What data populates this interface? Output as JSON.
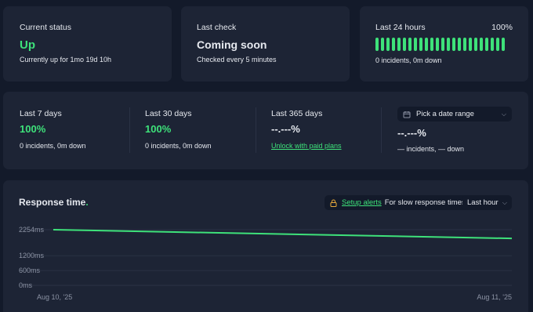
{
  "status": {
    "label": "Current status",
    "value": "Up",
    "detail": "Currently up for 1mo 19d 10h"
  },
  "last_check": {
    "label": "Last check",
    "value": "Coming soon",
    "detail": "Checked every 5 minutes"
  },
  "last_24h": {
    "label": "Last 24 hours",
    "percent": "100%",
    "detail": "0 incidents, 0m down",
    "bar_count": 24,
    "bar_color": "#3ee27a"
  },
  "periods": [
    {
      "label": "Last 7 days",
      "value": "100%",
      "detail": "0 incidents, 0m down"
    },
    {
      "label": "Last 30 days",
      "value": "100%",
      "detail": "0 incidents, 0m down"
    },
    {
      "label": "Last 365 days",
      "value": "--.---%",
      "link": "Unlock with paid plans"
    }
  ],
  "date_range": {
    "picker_label": "Pick a date range",
    "value": "--.---%",
    "detail": "— incidents, — down",
    "icon": "calendar-icon"
  },
  "response": {
    "title": "Response time",
    "title_dot": ".",
    "alert_link": "Setup alerts",
    "alert_text": "For slow response times",
    "alert_icon": "lock-icon",
    "range_select": "Last hour"
  },
  "chart_data": {
    "type": "line",
    "title": "Response time.",
    "x": [
      "Aug 10, '25",
      "Aug 11, '25"
    ],
    "series": [
      {
        "values": [
          2254,
          1900
        ]
      }
    ],
    "y_ticks": [
      "2254ms",
      "1200ms",
      "600ms",
      "0ms"
    ],
    "y_tick_values": [
      2254,
      1200,
      600,
      0
    ],
    "ylim": [
      0,
      2254
    ],
    "grid": true,
    "line_color": "#3ee27a"
  },
  "colors": {
    "background": "#131a2a",
    "card": "#1d2435",
    "accent": "#3ee27a",
    "muted": "#8c93a4"
  }
}
